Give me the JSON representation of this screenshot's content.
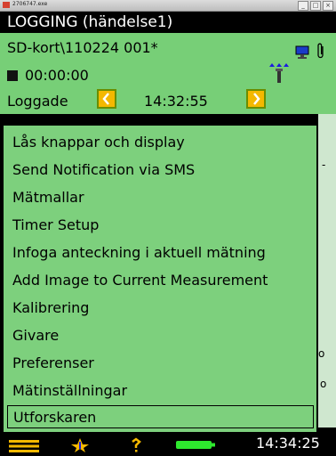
{
  "window": {
    "caption": "2706747.exe"
  },
  "header": {
    "title": "LOGGING (händelse1)"
  },
  "file": {
    "path": "SD-kort\\110224 001*"
  },
  "recorder": {
    "elapsed": "00:00:00"
  },
  "log_nav": {
    "label": "Loggade",
    "time": "14:32:55"
  },
  "menu": {
    "items": [
      "Lås knappar och display",
      "Send Notification via SMS",
      "Mätmallar",
      "Timer Setup",
      "Infoga anteckning i aktuell mätning",
      "Add Image to Current Measurement",
      "Kalibrering",
      "Givare",
      "Preferenser",
      "Mätinställningar",
      "Utforskaren"
    ],
    "selected_index": 10
  },
  "status_bar": {
    "clock": "14:34:25"
  },
  "colors": {
    "accent_green": "#77cf77",
    "nav_yellow": "#f4b800",
    "battery_green": "#2ee82e"
  }
}
